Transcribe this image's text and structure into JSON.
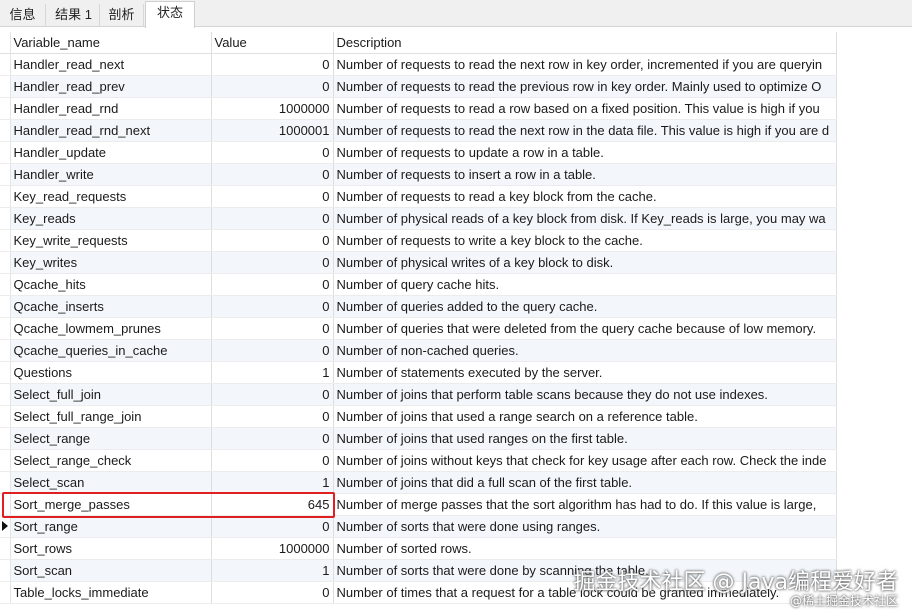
{
  "tabs": [
    {
      "label": "信息"
    },
    {
      "label": "结果 1"
    },
    {
      "label": "剖析"
    },
    {
      "label": "状态"
    }
  ],
  "columns": {
    "name": "Variable_name",
    "value": "Value",
    "description": "Description"
  },
  "rows": [
    {
      "name": "Handler_read_next",
      "value": "0",
      "description": "Number of requests to read the next row in key order, incremented if you are queryin"
    },
    {
      "name": "Handler_read_prev",
      "value": "0",
      "description": "Number of requests to read the previous row in key order. Mainly used to optimize O"
    },
    {
      "name": "Handler_read_rnd",
      "value": "1000000",
      "description": "Number of requests to read a row based on a fixed position. This value is high if you"
    },
    {
      "name": "Handler_read_rnd_next",
      "value": "1000001",
      "description": "Number of requests to read the next row in the data file. This value is high if you are d"
    },
    {
      "name": "Handler_update",
      "value": "0",
      "description": "Number of requests to update a row in a table."
    },
    {
      "name": "Handler_write",
      "value": "0",
      "description": "Number of requests to insert a row in a table."
    },
    {
      "name": "Key_read_requests",
      "value": "0",
      "description": "Number of requests to read a key block from the cache."
    },
    {
      "name": "Key_reads",
      "value": "0",
      "description": "Number of physical reads of a key block from disk. If Key_reads is large, you may wa"
    },
    {
      "name": "Key_write_requests",
      "value": "0",
      "description": "Number of requests to write a key block to the cache."
    },
    {
      "name": "Key_writes",
      "value": "0",
      "description": "Number of physical writes of a key block to disk."
    },
    {
      "name": "Qcache_hits",
      "value": "0",
      "description": "Number of query cache hits."
    },
    {
      "name": "Qcache_inserts",
      "value": "0",
      "description": "Number of queries added to the query cache."
    },
    {
      "name": "Qcache_lowmem_prunes",
      "value": "0",
      "description": "Number of queries that were deleted from the query cache because of low memory."
    },
    {
      "name": "Qcache_queries_in_cache",
      "value": "0",
      "description": "Number of non-cached queries."
    },
    {
      "name": "Questions",
      "value": "1",
      "description": "Number of statements executed by the server."
    },
    {
      "name": "Select_full_join",
      "value": "0",
      "description": "Number of joins that perform table scans because they do not use indexes."
    },
    {
      "name": "Select_full_range_join",
      "value": "0",
      "description": "Number of joins that used a range search on a reference table."
    },
    {
      "name": "Select_range",
      "value": "0",
      "description": "Number of joins that used ranges on the first table."
    },
    {
      "name": "Select_range_check",
      "value": "0",
      "description": "Number of joins without keys that check for key usage after each row. Check the inde"
    },
    {
      "name": "Select_scan",
      "value": "1",
      "description": "Number of joins that did a full scan of the first table."
    },
    {
      "name": "Sort_merge_passes",
      "value": "645",
      "description": "Number of merge passes that the sort algorithm has had to do. If this value is large,"
    },
    {
      "name": "Sort_range",
      "value": "0",
      "description": "Number of sorts that were done using ranges."
    },
    {
      "name": "Sort_rows",
      "value": "1000000",
      "description": "Number of sorted rows."
    },
    {
      "name": "Sort_scan",
      "value": "1",
      "description": "Number of sorts that were done by scanning the table."
    },
    {
      "name": "Table_locks_immediate",
      "value": "0",
      "description": "Number of times that a request for a table lock could be granted immediately."
    }
  ],
  "watermark": {
    "line1": "掘金技术社区 @ Java编程爱好者",
    "line2": "@稀土掘金技术社区"
  },
  "colors": {
    "highlight": "#e02020",
    "alt_row": "#f3f7fb"
  }
}
